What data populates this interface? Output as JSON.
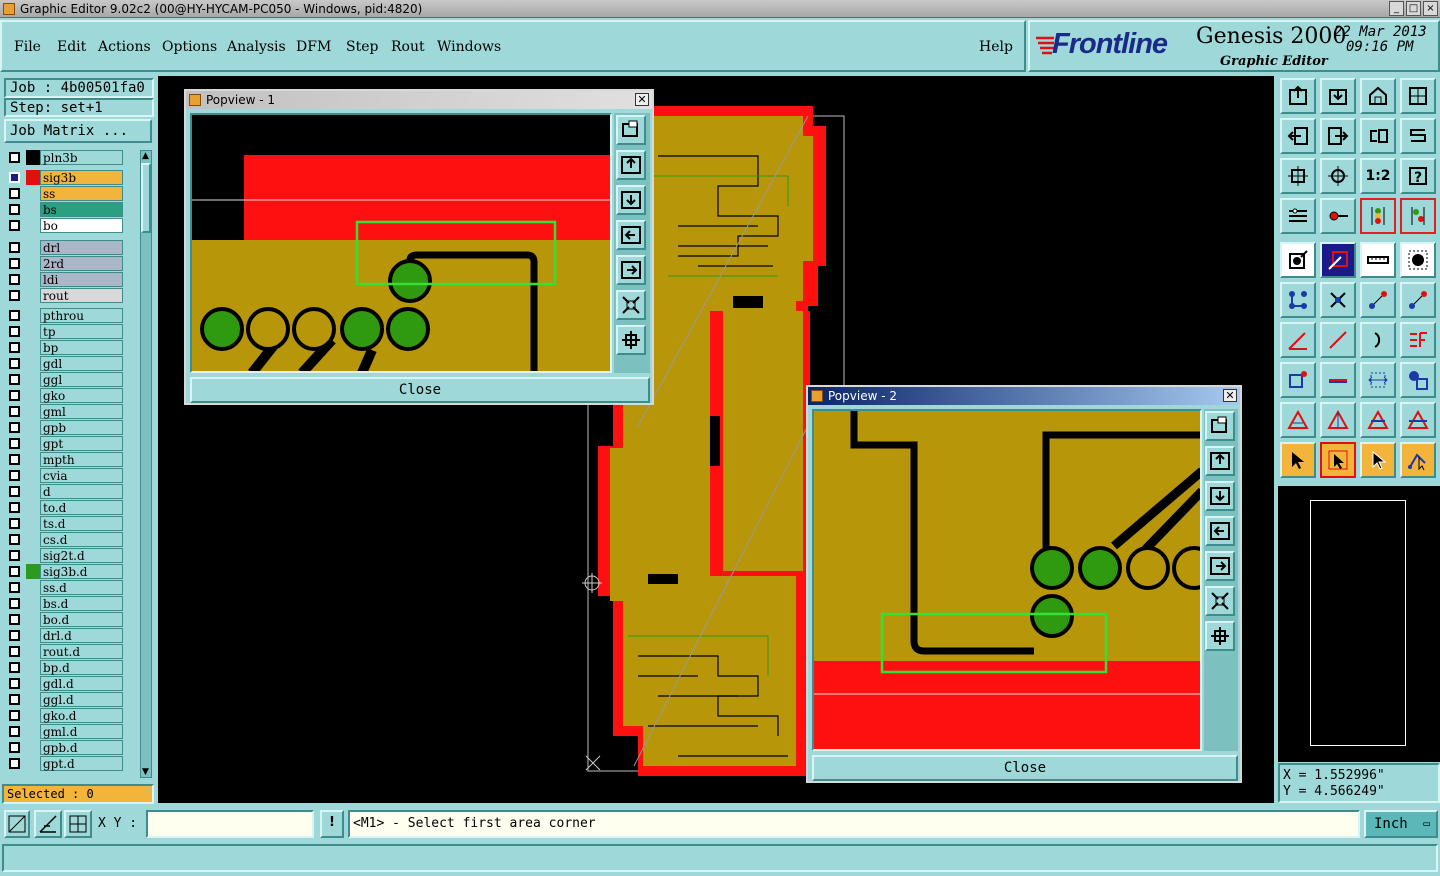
{
  "window": {
    "title": "Graphic Editor 9.02c2 (00@HY-HYCAM-PC050 - Windows, pid:4820)"
  },
  "menu": [
    "File",
    "Edit",
    "Actions",
    "Options",
    "Analysis",
    "DFM",
    "Step",
    "Rout",
    "Windows"
  ],
  "help": "Help",
  "brand": {
    "logo": "Frontline",
    "product": "Genesis 2000",
    "subtitle": "Graphic Editor",
    "date": "22 Mar 2013",
    "time": "09:16 PM"
  },
  "job": {
    "job_label": "Job : 4b00501fa0",
    "step_label": "Step: set+1",
    "matrix_button": "Job Matrix ..."
  },
  "layers": [
    {
      "name": "pln3b",
      "bg": "#9ed8d8",
      "color": "#000"
    },
    {
      "name": "sig3b",
      "bg": "#f3b43c",
      "color": "#e01010",
      "active": true
    },
    {
      "name": "ss",
      "bg": "#f3b43c",
      "color": "#9ed8d8"
    },
    {
      "name": "bs",
      "bg": "#2aa080",
      "color": "#9ed8d8"
    },
    {
      "name": "bo",
      "bg": "#ffffff",
      "color": "#9ed8d8"
    },
    {
      "name": "drl",
      "bg": "#a8b8c8",
      "color": "#9ed8d8"
    },
    {
      "name": "2rd",
      "bg": "#a8b8c8",
      "color": "#9ed8d8"
    },
    {
      "name": "ldi",
      "bg": "#a8b8c8",
      "color": "#9ed8d8"
    },
    {
      "name": "rout",
      "bg": "#d8d8d8",
      "color": "#9ed8d8"
    },
    {
      "name": "pthrou",
      "bg": "#9ed8d8",
      "color": "#9ed8d8"
    },
    {
      "name": "tp",
      "bg": "#9ed8d8",
      "color": "#9ed8d8"
    },
    {
      "name": "bp",
      "bg": "#9ed8d8",
      "color": "#9ed8d8"
    },
    {
      "name": "gdl",
      "bg": "#9ed8d8",
      "color": "#9ed8d8"
    },
    {
      "name": "ggl",
      "bg": "#9ed8d8",
      "color": "#9ed8d8"
    },
    {
      "name": "gko",
      "bg": "#9ed8d8",
      "color": "#9ed8d8"
    },
    {
      "name": "gml",
      "bg": "#9ed8d8",
      "color": "#9ed8d8"
    },
    {
      "name": "gpb",
      "bg": "#9ed8d8",
      "color": "#9ed8d8"
    },
    {
      "name": "gpt",
      "bg": "#9ed8d8",
      "color": "#9ed8d8"
    },
    {
      "name": "mpth",
      "bg": "#9ed8d8",
      "color": "#9ed8d8"
    },
    {
      "name": "cvia",
      "bg": "#9ed8d8",
      "color": "#9ed8d8"
    },
    {
      "name": "d",
      "bg": "#9ed8d8",
      "color": "#9ed8d8"
    },
    {
      "name": "to.d",
      "bg": "#9ed8d8",
      "color": "#9ed8d8"
    },
    {
      "name": "ts.d",
      "bg": "#9ed8d8",
      "color": "#9ed8d8"
    },
    {
      "name": "cs.d",
      "bg": "#9ed8d8",
      "color": "#9ed8d8"
    },
    {
      "name": "sig2t.d",
      "bg": "#9ed8d8",
      "color": "#9ed8d8"
    },
    {
      "name": "sig3b.d",
      "bg": "#9ed8d8",
      "color": "#2a9a20"
    },
    {
      "name": "ss.d",
      "bg": "#9ed8d8",
      "color": "#9ed8d8"
    },
    {
      "name": "bs.d",
      "bg": "#9ed8d8",
      "color": "#9ed8d8"
    },
    {
      "name": "bo.d",
      "bg": "#9ed8d8",
      "color": "#9ed8d8"
    },
    {
      "name": "drl.d",
      "bg": "#9ed8d8",
      "color": "#9ed8d8"
    },
    {
      "name": "rout.d",
      "bg": "#9ed8d8",
      "color": "#9ed8d8"
    },
    {
      "name": "bp.d",
      "bg": "#9ed8d8",
      "color": "#9ed8d8"
    },
    {
      "name": "gdl.d",
      "bg": "#9ed8d8",
      "color": "#9ed8d8"
    },
    {
      "name": "ggl.d",
      "bg": "#9ed8d8",
      "color": "#9ed8d8"
    },
    {
      "name": "gko.d",
      "bg": "#9ed8d8",
      "color": "#9ed8d8"
    },
    {
      "name": "gml.d",
      "bg": "#9ed8d8",
      "color": "#9ed8d8"
    },
    {
      "name": "gpb.d",
      "bg": "#9ed8d8",
      "color": "#9ed8d8"
    },
    {
      "name": "gpt.d",
      "bg": "#9ed8d8",
      "color": "#9ed8d8"
    }
  ],
  "selected": "Selected : 0",
  "popview1": {
    "title": "Popview - 1",
    "close": "Close"
  },
  "popview2": {
    "title": "Popview - 2",
    "close": "Close"
  },
  "coords": {
    "x": "X = 1.552996\"",
    "y": "Y = 4.566249\""
  },
  "bottom": {
    "xy_label": "X Y :",
    "xy_value": "",
    "prompt": "<M1> - Select first area corner",
    "units": "Inch"
  },
  "colors": {
    "copper": "#b8960a",
    "red": "#ff1010",
    "green": "#2f9a10",
    "panel": "#9ed8d8",
    "accent_orange": "#f3b43c"
  }
}
